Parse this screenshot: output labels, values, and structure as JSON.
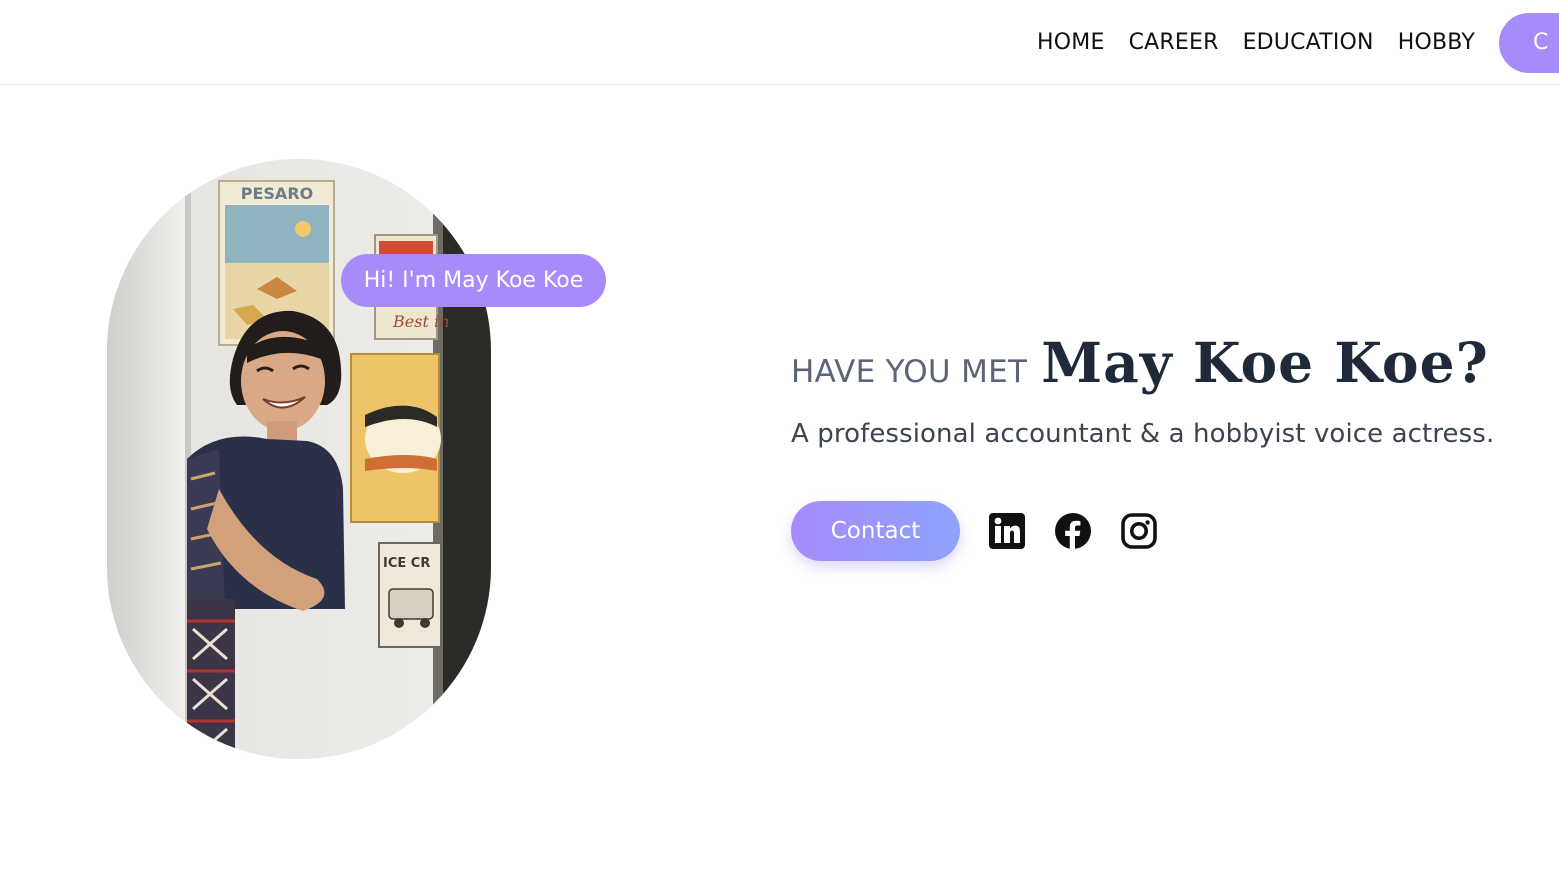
{
  "nav": {
    "items": [
      {
        "label": "HOME"
      },
      {
        "label": "CAREER"
      },
      {
        "label": "EDUCATION"
      },
      {
        "label": "HOBBY"
      }
    ],
    "cta_label": "C"
  },
  "hero": {
    "greeting": "Hi! I'm May Koe Koe",
    "pre_title": "HAVE YOU MET",
    "name": "May Koe Koe?",
    "subtitle": "A professional accountant & a hobbyist voice actress.",
    "contact_label": "Contact",
    "social": [
      {
        "icon": "linkedin-icon"
      },
      {
        "icon": "facebook-icon"
      },
      {
        "icon": "instagram-icon"
      }
    ]
  },
  "photo": {
    "poster_text_1": "PESARO",
    "poster_text_2": "Best in",
    "poster_text_3": "ICE CR"
  },
  "colors": {
    "accent": "#a78bfa",
    "accent_end": "#8ea2fb",
    "heading": "#1e2a3a",
    "muted": "#5b6577"
  }
}
